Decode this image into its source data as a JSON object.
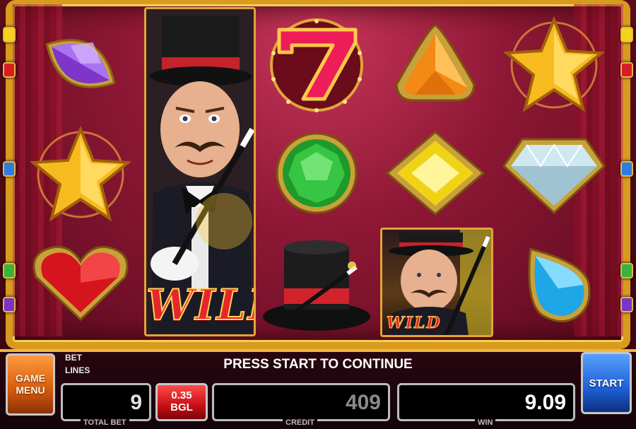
{
  "buttons": {
    "game_menu": [
      "GAME",
      "MENU"
    ],
    "start": "START"
  },
  "labels": {
    "bet": "BET",
    "lines": "LINES",
    "message": "PRESS START TO CONTINUE"
  },
  "meters": {
    "total_bet": {
      "label": "TOTAL BET",
      "value": "9"
    },
    "denomination": {
      "value": "0.35",
      "currency": "BGL"
    },
    "credit": {
      "label": "CREDIT",
      "value": "409"
    },
    "win": {
      "label": "WIN",
      "value": "9.09"
    }
  },
  "reels": [
    [
      "purple-marquise-gem",
      "gold-star",
      "red-heart-gem"
    ],
    [
      "magician-wild-stacked"
    ],
    [
      "red-seven",
      "green-round-gem",
      "top-hat-wand"
    ],
    [
      "orange-trillion-gem",
      "yellow-square-gem",
      "magician-wild"
    ],
    [
      "gold-star",
      "diamond-gem",
      "blue-pear-gem"
    ]
  ],
  "wild_text": "WILD",
  "colors": {
    "frame_gold": "#d99b1e",
    "stage_red": "#8d1734",
    "menu_orange": "#ff9b3d",
    "start_blue": "#1d5fd6",
    "denom_red": "#c90f14"
  },
  "side_lights_left": [
    "#f5d21e",
    "#d81b25",
    "#2f7de0",
    "#3ab33a",
    "#7a34c8"
  ],
  "side_lights_right": [
    "#f5d21e",
    "#d81b25",
    "#2f7de0",
    "#3ab33a",
    "#7a34c8"
  ]
}
